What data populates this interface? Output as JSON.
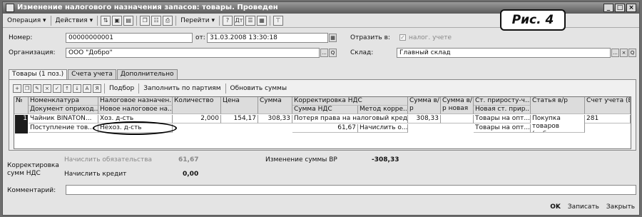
{
  "window": {
    "title": "Изменение налогового назначения запасов: товары. Проведен"
  },
  "toolbar": {
    "operation": "Операция",
    "actions": "Действия",
    "goto": "Перейти"
  },
  "badge": "Рис. 4",
  "header": {
    "number_label": "Номер:",
    "number_value": "00000000001",
    "date_label": "от:",
    "date_value": "31.03.2008 13:30:18",
    "reflect_label": "Отразить в:",
    "reflect_option": "налог. учете",
    "org_label": "Организация:",
    "org_value": "ООО \"Добро\"",
    "warehouse_label": "Склад:",
    "warehouse_value": "Главный склад"
  },
  "tabs": [
    "Товары (1 поз.)",
    "Счета учета",
    "Дополнительно"
  ],
  "table_toolbar": {
    "selection": "Подбор",
    "fill": "Заполнить по партиям",
    "update": "Обновить суммы"
  },
  "table": {
    "headers": {
      "no": "№",
      "nomen": "Номенклатура",
      "nomen2": "Документ оприход...",
      "taxdest": "Налоговое назначен...",
      "taxdest2": "Новое налоговое на...",
      "qty": "Количество",
      "price": "Цена",
      "sum": "Сумма",
      "vatcorr": "Корректировка НДС",
      "vatsum": "Сумма НДС",
      "method": "Метод корре...",
      "sumvr": "Сумма в/р",
      "sumvrnew": "Сумма в/р новая",
      "ststep": "Ст. приросту-ч...",
      "ststep2": "Новая ст. прир...",
      "itemvr": "Статья в/р",
      "account": "Счет учета (БУ)"
    },
    "row": {
      "no": "1",
      "nomen": "Чайник BINATON...",
      "doc": "Поступление тов...",
      "taxdest": "Хоз. д-сть",
      "taxdest_new": "Нехоз. д-сть",
      "qty": "2,000",
      "price": "154,17",
      "sum": "308,33",
      "vatcorr": "Потеря права на налоговый кредит",
      "vatsum": "61,67",
      "method": "Начислить о...",
      "sumvr": "308,33",
      "sumvrnew": "",
      "ststep": "Товары на опт...",
      "ststep2": "Товары на опт...",
      "itemvr": "Покупка товаров (работ...",
      "account": "281"
    }
  },
  "footer": {
    "vat_corr_label": "Корректировка сумм НДС",
    "accrue_liab_label": "Начислить обязательства",
    "accrue_liab_value": "61,67",
    "accrue_credit_label": "Начислить кредит",
    "accrue_credit_value": "0,00",
    "vr_change_label": "Изменение суммы ВР",
    "vr_change_value": "-308,33",
    "comment_label": "Комментарий:"
  },
  "buttons": {
    "ok": "OK",
    "save": "Записать",
    "close": "Закрыть"
  }
}
